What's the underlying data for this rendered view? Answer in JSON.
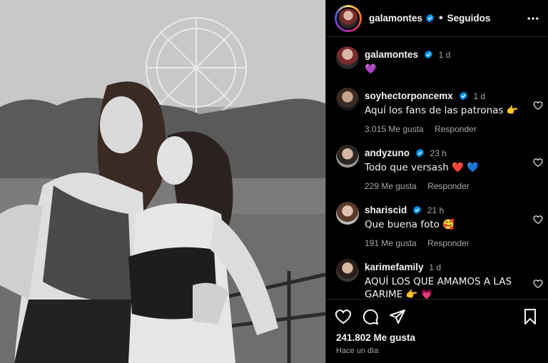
{
  "post": {
    "author": "galamontes",
    "follow_status": "Seguidos",
    "separator": "•"
  },
  "caption": {
    "username": "galamontes",
    "time": "1 d",
    "text": "💜"
  },
  "comments": [
    {
      "username": "soyhectorponcemx",
      "time": "1 d",
      "text": "Aquí los fans de las patronas 👉",
      "likes": "3.015 Me gusta",
      "reply": "Responder"
    },
    {
      "username": "andyzuno",
      "time": "23 h",
      "text": "Todo que versash ❤️ 💙",
      "likes": "229 Me gusta",
      "reply": "Responder"
    },
    {
      "username": "shariscid",
      "time": "21 h",
      "text": "Que buena foto 🥰",
      "likes": "191 Me gusta",
      "reply": "Responder"
    },
    {
      "username": "karimefamily",
      "time": "1 d",
      "text": "AQUÍ LOS QUE AMAMOS A LAS GARIME 👉 💗",
      "likes": "",
      "reply": ""
    }
  ],
  "footer": {
    "likes": "241.802 Me gusta",
    "posted": "Hace un día"
  },
  "icons": {
    "verified": "verified-badge-icon",
    "more": "more-options-icon",
    "like": "heart-icon",
    "comment": "comment-icon",
    "share": "share-icon",
    "save": "bookmark-icon"
  },
  "colors": {
    "background": "#000000",
    "verified": "#0095f6",
    "muted_text": "#a8a8a8",
    "divider": "#262626"
  }
}
